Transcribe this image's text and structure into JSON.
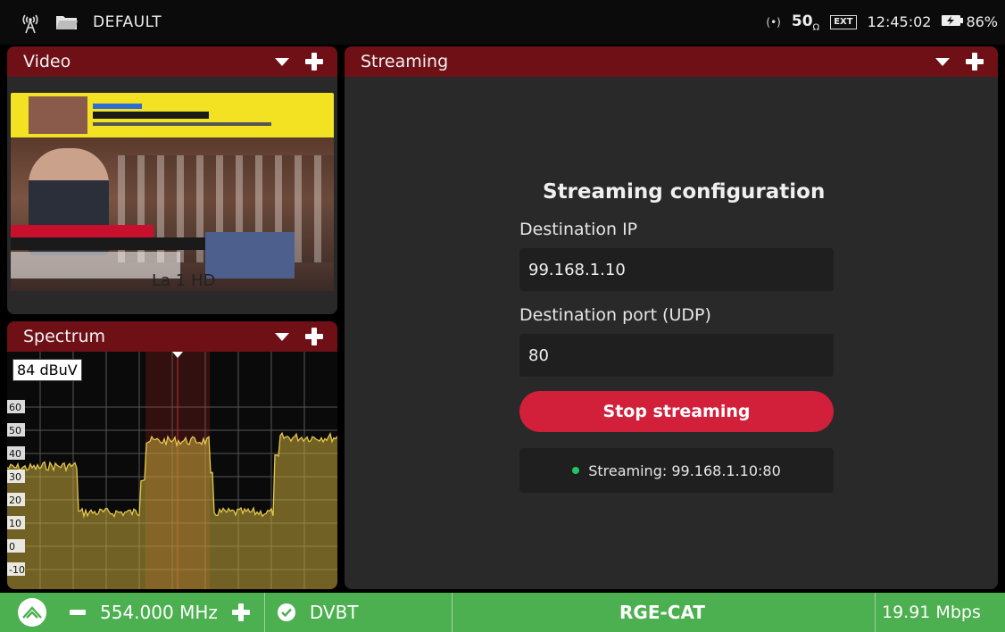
{
  "statusbar": {
    "profile": "DEFAULT",
    "signal_indicator": "(•)",
    "impedance": "50",
    "impedance_unit": "Ω",
    "ext_label": "EXT",
    "time": "12:45:02",
    "battery": "86%"
  },
  "video_panel": {
    "title": "Video",
    "channel_logo": "La 1 HD"
  },
  "spectrum_panel": {
    "title": "Spectrum",
    "ref_level": "84 dBuV",
    "y_ticks": [
      "60",
      "50",
      "40",
      "30",
      "20",
      "10",
      "0",
      "-10"
    ]
  },
  "streaming_panel": {
    "title": "Streaming",
    "heading": "Streaming configuration",
    "ip_label": "Destination IP",
    "ip_value": "99.168.1.10",
    "port_label": "Destination port (UDP)",
    "port_value": "80",
    "stop_button": "Stop streaming",
    "status": "Streaming: 99.168.1.10:80"
  },
  "bottombar": {
    "frequency": "554.000 MHz",
    "standard": "DVBT",
    "channel_name": "RGE-CAT",
    "bitrate": "19.91 Mbps"
  },
  "colors": {
    "panel_header": "#6e1016",
    "panel_bg": "#292929",
    "accent_red": "#d21f3a",
    "bottom_green": "#4caf50",
    "status_green": "#22c55e",
    "spectrum_trace": "#e6c84a"
  }
}
